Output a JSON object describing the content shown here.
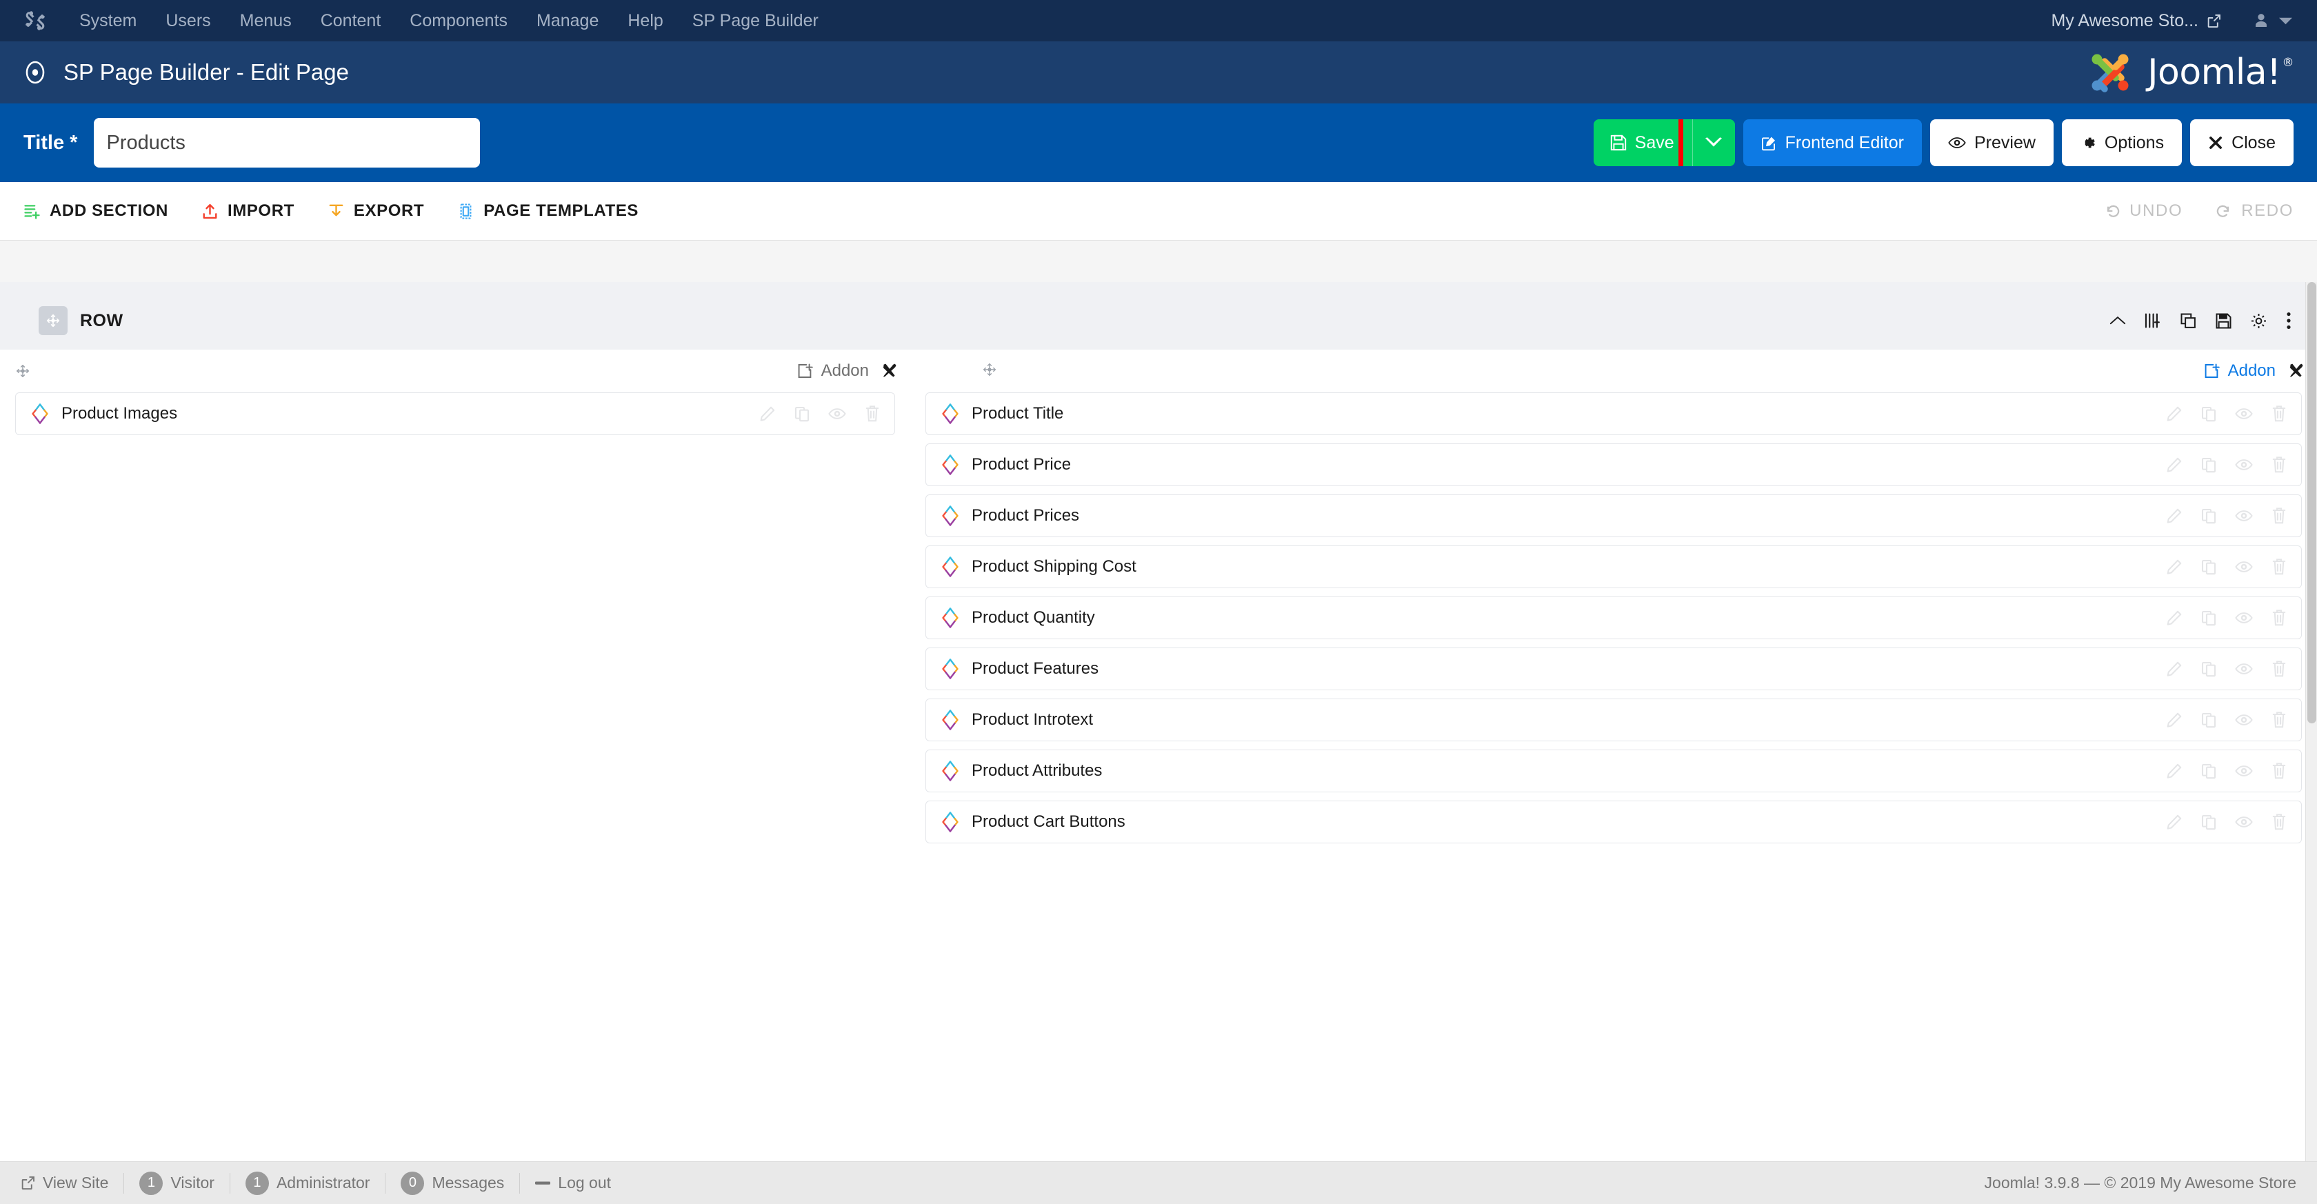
{
  "admin_bar": {
    "logo_icon": "joomla-mark-icon",
    "menu": [
      {
        "label": "System"
      },
      {
        "label": "Users"
      },
      {
        "label": "Menus"
      },
      {
        "label": "Content"
      },
      {
        "label": "Components"
      },
      {
        "label": "Manage"
      },
      {
        "label": "Help"
      },
      {
        "label": "SP Page Builder"
      }
    ],
    "site_name": "My Awesome Sto...",
    "external_link_icon": "external-link-icon",
    "user_icon": "user-icon",
    "user_caret_icon": "chevron-down-icon"
  },
  "pb_header": {
    "title": "SP Page Builder - Edit Page",
    "title_icon": "target-dot-icon",
    "brand_text": "Joomla!",
    "brand_trademark": "®",
    "brand_logo_icon": "joomla-logo-icon"
  },
  "title_bar": {
    "label": "Title *",
    "value": "Products",
    "placeholder": "Title"
  },
  "toolbar": {
    "save_label": "Save",
    "save_icon": "floppy-disk-icon",
    "save_caret_icon": "chevron-down-icon",
    "save_highlighted": true,
    "highlight_color": "#ff0000",
    "save_color": "#00d264",
    "frontend_label": "Frontend Editor",
    "frontend_icon": "pencil-square-icon",
    "frontend_color": "#0d7ae4",
    "preview_label": "Preview",
    "preview_icon": "eye-icon",
    "options_label": "Options",
    "options_icon": "gear-icon",
    "close_label": "Close",
    "close_icon": "x-icon"
  },
  "action_bar": {
    "add_section_label": "ADD SECTION",
    "add_section_icon": "add-section-icon",
    "import_label": "IMPORT",
    "import_icon": "upload-icon",
    "export_label": "EXPORT",
    "export_icon": "download-icon",
    "page_templates_label": "PAGE TEMPLATES",
    "page_templates_icon": "page-template-icon",
    "undo_label": "UNDO",
    "undo_icon": "undo-arrow-icon",
    "redo_label": "REDO",
    "redo_icon": "redo-arrow-icon"
  },
  "row": {
    "label": "ROW",
    "drag_icon": "move-arrows-icon",
    "tools": [
      {
        "name": "collapse-row",
        "icon": "chevron-up-icon"
      },
      {
        "name": "add-column",
        "icon": "add-column-icon"
      },
      {
        "name": "duplicate-row",
        "icon": "duplicate-icon"
      },
      {
        "name": "save-row",
        "icon": "floppy-disk-icon"
      },
      {
        "name": "row-settings",
        "icon": "gear-icon"
      },
      {
        "name": "row-more",
        "icon": "kebab-menu-icon"
      }
    ]
  },
  "columns": [
    {
      "id": "left",
      "drag_icon": "move-arrows-icon",
      "addon_label": "Addon",
      "addon_icon": "add-box-icon",
      "addon_active": false,
      "settings_icon": "tools-icon",
      "addons": [
        {
          "label": "Product Images"
        }
      ]
    },
    {
      "id": "right",
      "drag_icon": "move-arrows-icon",
      "addon_label": "Addon",
      "addon_icon": "add-box-icon",
      "addon_active": true,
      "settings_icon": "tools-icon",
      "addons": [
        {
          "label": "Product Title"
        },
        {
          "label": "Product Price"
        },
        {
          "label": "Product Prices"
        },
        {
          "label": "Product Shipping Cost"
        },
        {
          "label": "Product Quantity"
        },
        {
          "label": "Product Features"
        },
        {
          "label": "Product Introtext"
        },
        {
          "label": "Product Attributes"
        },
        {
          "label": "Product Cart Buttons"
        }
      ]
    }
  ],
  "addon_row_actions": [
    {
      "name": "edit-addon",
      "icon": "pencil-icon"
    },
    {
      "name": "duplicate-addon",
      "icon": "duplicate-icon"
    },
    {
      "name": "toggle-visibility-addon",
      "icon": "eye-icon"
    },
    {
      "name": "delete-addon",
      "icon": "trash-icon"
    }
  ],
  "statusbar": {
    "view_site_label": "View Site",
    "view_site_icon": "external-link-icon",
    "visitor_count": "1",
    "visitor_label": "Visitor",
    "administrator_count": "1",
    "administrator_label": "Administrator",
    "messages_count": "0",
    "messages_label": "Messages",
    "logout_label": "Log out",
    "logout_icon": "minus-icon",
    "version_text": "Joomla! 3.9.8  —  © 2019 My Awesome Store"
  }
}
